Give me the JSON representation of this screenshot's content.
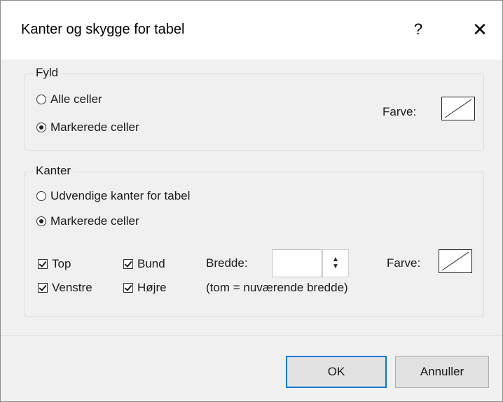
{
  "dialog": {
    "title": "Kanter og skygge for tabel",
    "help_label": "?",
    "close_label": "✕"
  },
  "fill": {
    "legend": "Fyld",
    "options": [
      {
        "label": "Alle celler",
        "selected": false
      },
      {
        "label": "Markerede celler",
        "selected": true
      }
    ],
    "color_label": "Farve:"
  },
  "borders": {
    "legend": "Kanter",
    "options": [
      {
        "label": "Udvendige kanter for tabel",
        "selected": false
      },
      {
        "label": "Markerede celler",
        "selected": true
      }
    ],
    "checkboxes": {
      "top": {
        "label": "Top",
        "checked": true
      },
      "bottom": {
        "label": "Bund",
        "checked": true
      },
      "left": {
        "label": "Venstre",
        "checked": true
      },
      "right": {
        "label": "Højre",
        "checked": true
      }
    },
    "width_label": "Bredde:",
    "width_value": "",
    "width_hint": "(tom = nuværende bredde)",
    "color_label": "Farve:"
  },
  "footer": {
    "ok_label": "OK",
    "cancel_label": "Annuller"
  },
  "colors": {
    "dialog_bg": "#f0f0f0",
    "titlebar_bg": "#ffffff",
    "primary_border": "#0078d7"
  }
}
